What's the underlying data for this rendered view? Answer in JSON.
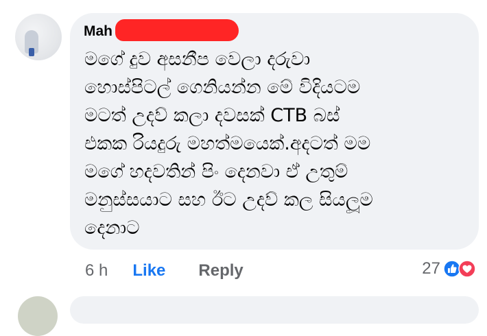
{
  "comment": {
    "author": "Mah",
    "text": "මගේ දුව අසනීප වෙලා  දරුවා\nහොස්පිටල් ගෙනියන්න මේ විදියටම\nමටත් උදව් කලා දවසක් CTB  බස්\nඑකක රියදුරු මහත්මයෙක්.අදටත් මම\nමගේ හදවතින් පිං දෙනවා ඒ උතුම්\nමනුස්සයාට සහ ඊට උදව් කල සියලූම\nදෙනාට",
    "time": "6 h",
    "like_label": "Like",
    "reply_label": "Reply",
    "reaction_count": "27",
    "reactions": [
      "like-icon",
      "love-icon"
    ]
  },
  "colors": {
    "bubble": "#f0f2f5",
    "like_blue": "#1877f2",
    "meta_gray": "#65676b",
    "love_red": "#f33e58",
    "redaction": "#ff2525"
  }
}
